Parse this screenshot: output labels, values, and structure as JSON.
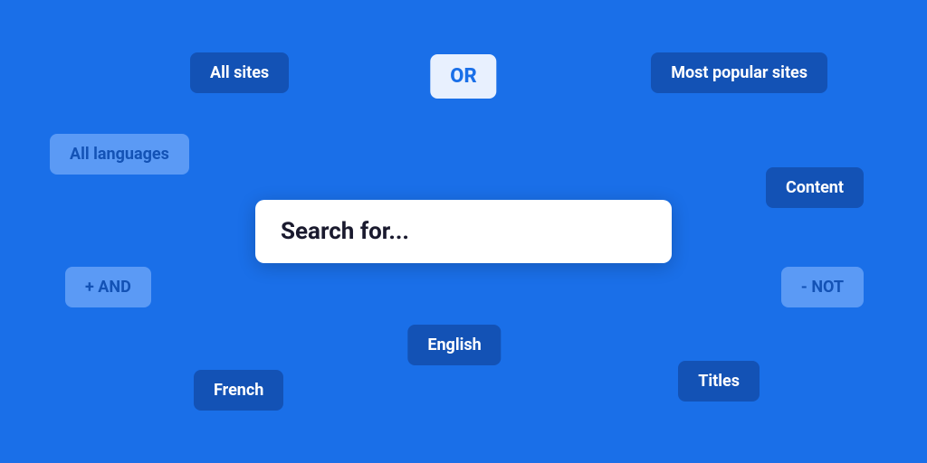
{
  "background": "#1a6fe8",
  "search": {
    "placeholder": "Search for..."
  },
  "chips": {
    "or": "OR",
    "all_sites": "All sites",
    "most_popular": "Most popular sites",
    "all_languages": "All languages",
    "content": "Content",
    "and": "+ AND",
    "not": "- NOT",
    "english": "English",
    "french": "French",
    "titles": "Titles"
  }
}
